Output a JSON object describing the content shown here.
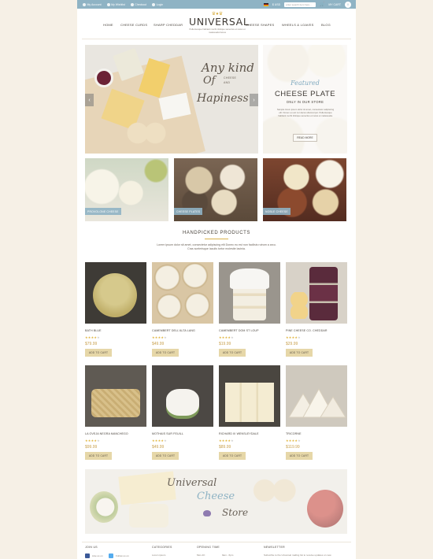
{
  "topbar": {
    "account": "My Account",
    "wishlist": "My Wishlist",
    "checkout": "Checkout",
    "login": "Login",
    "currency": "$ USD",
    "search_placeholder": "enter search item here...",
    "cart_label": "MY CART",
    "cart_count": "0"
  },
  "logo": {
    "name": "UNIVERSAL",
    "tagline": "Pellentesque habitant morbi tristique senectus et netus et malesuada fames"
  },
  "nav": {
    "left": [
      "HOME",
      "CHEESE CURDS",
      "SHARP CHEDDAR"
    ],
    "right": [
      "CHEESE SHAPES",
      "WHEELS & LOAVES",
      "BLOG"
    ]
  },
  "hero": {
    "line1": "Any kind",
    "small1": "CHEESE",
    "small2": "AND",
    "line2": "Of",
    "line3": "Hapiness",
    "prev": "‹",
    "next": "›"
  },
  "side_banner": {
    "featured": "Featured",
    "title": "CHEESE PLATE",
    "subtitle": "ONLY IN OUR STORE",
    "desc": "Sample lorem ipsum dolor sit amet, consectetur adipiscing elit. Donec eu est non lacus ullamcorper. Pellentesque habitant morbi tristique senectus et netus et malesuada.",
    "button": "READ MORE"
  },
  "categories": [
    "PROVOLONE CHEESE",
    "CHEESE PLATES",
    "NOBLE CHEESE"
  ],
  "handpicked": {
    "title": "HANDPICKED PRODUCTS",
    "desc": "Lorem ipsum dolor sit amet, consectetur adipiscing elit Donec eu est non facilisis rutrum a arcu. Cras scelerisque iaculis tortor molestie lacinia.",
    "products": [
      {
        "name": "BATH BLUE",
        "price": "$79.99",
        "rating": 4
      },
      {
        "name": "CAMEMBERT DELL'ALTA LANG",
        "price": "$49.99",
        "rating": 4
      },
      {
        "name": "CAMEMBERT DOM ST LOUP",
        "price": "$19.99",
        "rating": 4
      },
      {
        "name": "PINE CHEESE CO. CHEDDAR",
        "price": "$29.99",
        "rating": 4
      },
      {
        "name": "LA OVEJA NEGRA MANCHEGO",
        "price": "$99.99",
        "rating": 4
      },
      {
        "name": "MOTHAIS SUR FEUILL",
        "price": "$49.99",
        "rating": 4
      },
      {
        "name": "RICHARD III WENSLEYDALE",
        "price": "$89.99",
        "rating": 4
      },
      {
        "name": "TRICORNE",
        "price": "$119.99",
        "rating": 4
      }
    ],
    "add_label": "ADD TO CART"
  },
  "banner": {
    "line1": "Universal",
    "line2": "Cheese",
    "line3": "Store"
  },
  "footer": {
    "join": "JOIN US",
    "categories": "CATEGORIES",
    "categories_item": "Lorem ipsum",
    "opening": "OPENING TIME",
    "opening_day": "Mon-Fri",
    "opening_hours": "9am - 6pm",
    "newsletter": "NEWSLETTER",
    "newsletter_desc": "Subscribe to the Universal mailing list to receive updates on new",
    "like_label": "Like us on",
    "follow_label": "Follow us on"
  },
  "colors": {
    "accent": "#8fb3c4",
    "gold": "#d9b24c",
    "button": "#e6d7a8",
    "background": "#f6f0e6"
  }
}
